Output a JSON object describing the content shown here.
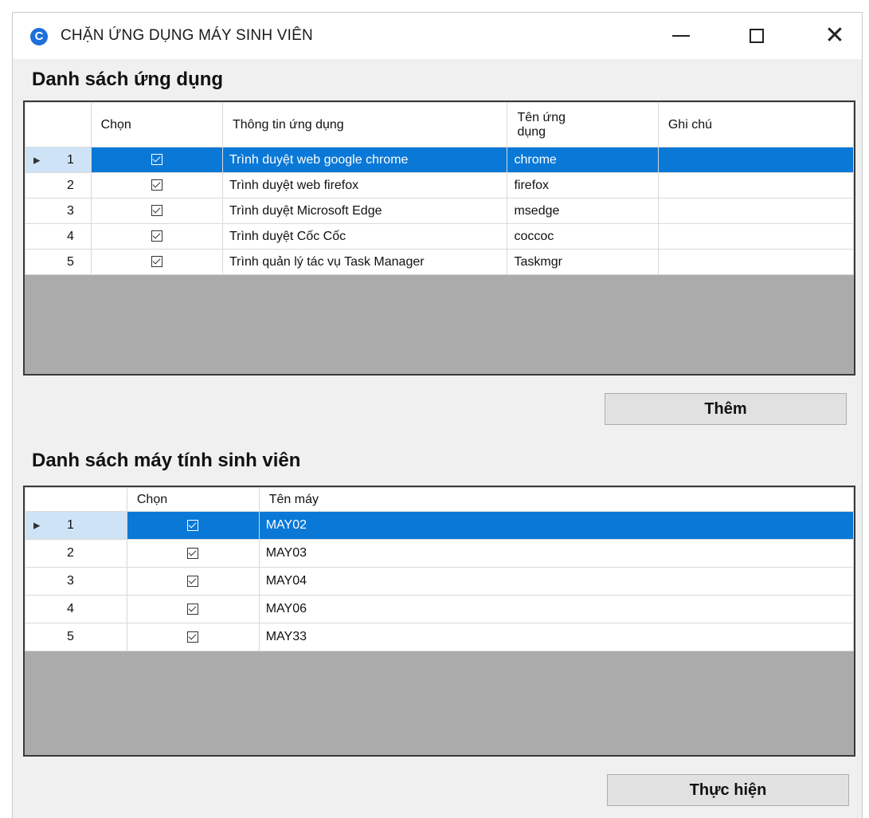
{
  "window": {
    "title": "CHẶN ỨNG DỤNG MÁY SINH VIÊN",
    "app_icon": "C"
  },
  "apps_section": {
    "title": "Danh sách ứng dụng",
    "columns": [
      "Chọn",
      "Thông tin ứng dụng",
      "Tên ứng\ndụng",
      "Ghi chú"
    ],
    "rows": [
      {
        "num": "1",
        "checked": true,
        "info": "Trình duyệt web google chrome",
        "name": "chrome",
        "note": ""
      },
      {
        "num": "2",
        "checked": true,
        "info": "Trình duyệt web firefox",
        "name": "firefox",
        "note": ""
      },
      {
        "num": "3",
        "checked": true,
        "info": "Trình duyệt Microsoft Edge",
        "name": "msedge",
        "note": ""
      },
      {
        "num": "4",
        "checked": true,
        "info": "Trình duyệt Cốc Cốc",
        "name": "coccoc",
        "note": ""
      },
      {
        "num": "5",
        "checked": true,
        "info": "Trình quản lý tác vụ Task Manager",
        "name": "Taskmgr",
        "note": ""
      }
    ],
    "selected_row": 0,
    "add_button": "Thêm"
  },
  "machines_section": {
    "title": "Danh sách máy tính sinh viên",
    "columns": [
      "Chọn",
      "Tên máy"
    ],
    "rows": [
      {
        "num": "1",
        "checked": true,
        "name": "MAY02"
      },
      {
        "num": "2",
        "checked": true,
        "name": "MAY03"
      },
      {
        "num": "3",
        "checked": true,
        "name": "MAY04"
      },
      {
        "num": "4",
        "checked": true,
        "name": "MAY06"
      },
      {
        "num": "5",
        "checked": true,
        "name": "MAY33"
      }
    ],
    "selected_row": 0,
    "execute_button": "Thực hiện"
  },
  "colors": {
    "selection": "#0a78d7",
    "grid_background": "#ababab",
    "window_background": "#f0f0f0"
  }
}
